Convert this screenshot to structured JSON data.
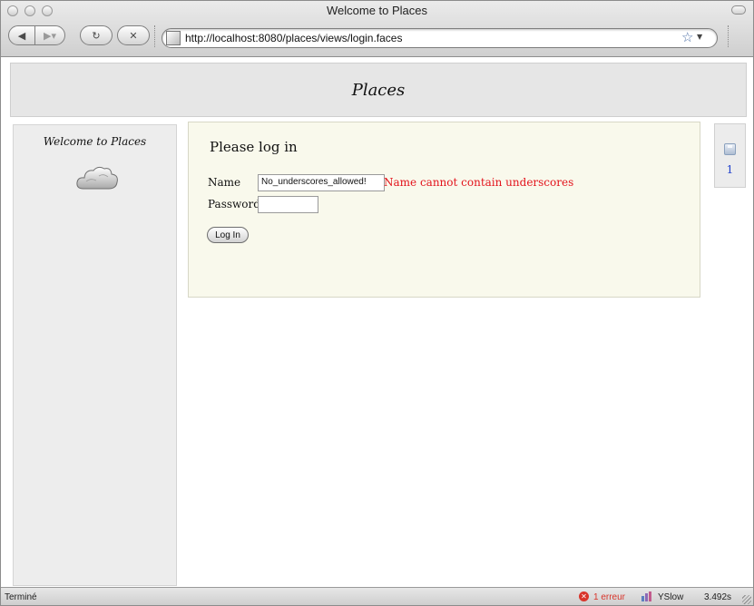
{
  "window": {
    "title": "Welcome to Places"
  },
  "toolbar": {
    "url": "http://localhost:8080/places/views/login.faces"
  },
  "page": {
    "header_title": "Places",
    "sidebar": {
      "title": "Welcome to Places",
      "image_icon": "cloud-icon"
    },
    "login": {
      "heading": "Please log in",
      "name_label": "Name",
      "name_value": "No_underscores_allowed!",
      "name_error": "Name cannot contain underscores",
      "password_label": "Password",
      "password_value": "",
      "submit_label": "Log In"
    },
    "counter": {
      "icon": "disk-icon",
      "value": "1"
    }
  },
  "statusbar": {
    "status": "Terminé",
    "error_count": "1 erreur",
    "yslow_label": "YSlow",
    "load_time": "3.492s"
  },
  "colors": {
    "error": "#e3141c",
    "link": "#1f3fcc",
    "content_bg": "#f9f9ec",
    "header_bg": "#e6e6e6"
  }
}
